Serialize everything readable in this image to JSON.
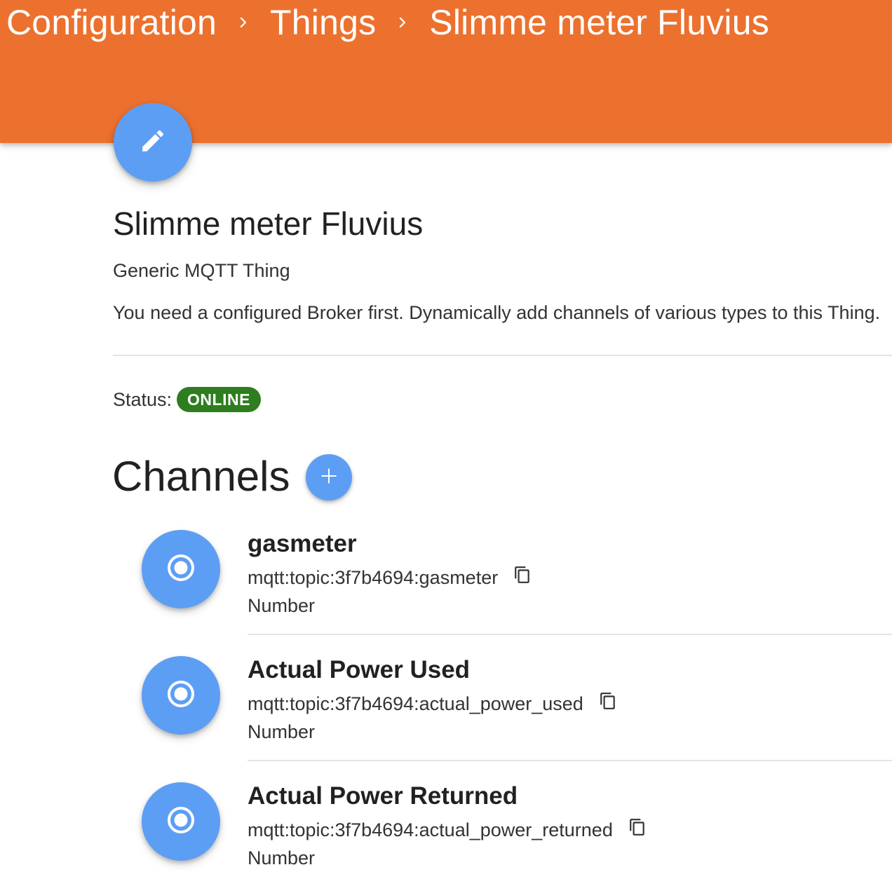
{
  "breadcrumb": {
    "items": [
      "Configuration",
      "Things",
      "Slimme meter Fluvius"
    ],
    "separator_icon": "chevron-right-icon"
  },
  "edit_button": {
    "icon": "pencil-icon"
  },
  "thing": {
    "title": "Slimme meter Fluvius",
    "type": "Generic MQTT Thing",
    "description": "You need a configured Broker first. Dynamically add channels of various types to this Thing."
  },
  "status": {
    "label": "Status:",
    "value": "ONLINE",
    "color": "#2e7d1f"
  },
  "channels": {
    "title": "Channels",
    "add_icon": "plus-icon",
    "items": [
      {
        "label": "gasmeter",
        "uid": "mqtt:topic:3f7b4694:gasmeter",
        "type": "Number",
        "icon": "radio-button-icon"
      },
      {
        "label": "Actual Power Used",
        "uid": "mqtt:topic:3f7b4694:actual_power_used",
        "type": "Number",
        "icon": "radio-button-icon"
      },
      {
        "label": "Actual Power Returned",
        "uid": "mqtt:topic:3f7b4694:actual_power_returned",
        "type": "Number",
        "icon": "radio-button-icon"
      }
    ]
  },
  "colors": {
    "toolbar": "#ec712f",
    "accent": "#5d9ef5",
    "online": "#2e7d1f"
  }
}
